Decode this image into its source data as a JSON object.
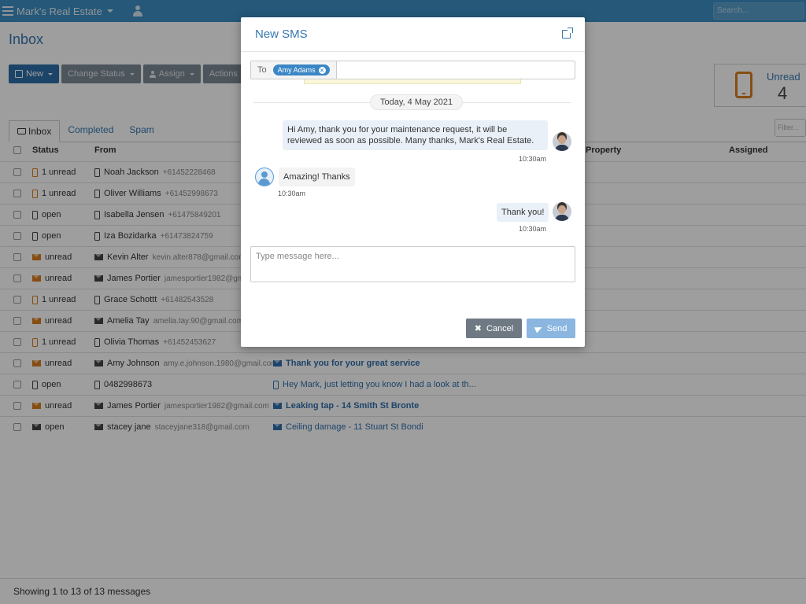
{
  "navbar": {
    "brand": "Mark's Real Estate",
    "search_placeholder": "Search..."
  },
  "page": {
    "title": "Inbox"
  },
  "toolbar": {
    "new_label": "New",
    "change_status_label": "Change Status",
    "assign_label": "Assign",
    "actions_label": "Actions"
  },
  "unread_panel": {
    "label": "Unread",
    "count": "4",
    "accent_color": "#d87c1e"
  },
  "tabs": [
    {
      "label": "Inbox"
    },
    {
      "label": "Completed"
    },
    {
      "label": "Spam"
    }
  ],
  "filter_placeholder": "Filter...",
  "columns": {
    "status": "Status",
    "from": "From",
    "property": "Property",
    "assigned": "Assigned"
  },
  "rows": [
    {
      "status_icon": "phone-icon",
      "status_color": "orange",
      "status": "1 unread",
      "from_icon": "phone-icon",
      "from_name": "Noah Jackson",
      "from_detail": "+61452228468",
      "subject": "",
      "subject_icon": ""
    },
    {
      "status_icon": "phone-icon",
      "status_color": "orange",
      "status": "1 unread",
      "from_icon": "phone-icon",
      "from_name": "Oliver Williams",
      "from_detail": "+61452998673",
      "subject": "",
      "subject_icon": ""
    },
    {
      "status_icon": "phone-icon",
      "status_color": "dark",
      "status": "open",
      "from_icon": "phone-icon",
      "from_name": "Isabella Jensen",
      "from_detail": "+61475849201",
      "subject": "",
      "subject_icon": ""
    },
    {
      "status_icon": "phone-icon",
      "status_color": "dark",
      "status": "open",
      "from_icon": "phone-icon",
      "from_name": "Iza Bozidarka",
      "from_detail": "+61473824759",
      "subject": "",
      "subject_icon": ""
    },
    {
      "status_icon": "envelope-icon",
      "status_color": "orange",
      "status": "unread",
      "from_icon": "envelope-icon",
      "from_name": "Kevin Alter",
      "from_detail": "kevin.alter878@gmail.com",
      "subject": "",
      "subject_icon": ""
    },
    {
      "status_icon": "envelope-icon",
      "status_color": "orange",
      "status": "unread",
      "from_icon": "envelope-icon",
      "from_name": "James Portier",
      "from_detail": "jamesportier1982@gmail.c",
      "subject": "",
      "subject_icon": ""
    },
    {
      "status_icon": "phone-icon",
      "status_color": "orange",
      "status": "1 unread",
      "from_icon": "phone-icon",
      "from_name": "Grace Schottt",
      "from_detail": "+61482543528",
      "subject": "",
      "subject_icon": ""
    },
    {
      "status_icon": "envelope-icon",
      "status_color": "orange",
      "status": "unread",
      "from_icon": "envelope-icon",
      "from_name": "Amelia Tay",
      "from_detail": "amelia.tay.90@gmail.com",
      "subject": "",
      "subject_icon": ""
    },
    {
      "status_icon": "phone-icon",
      "status_color": "orange",
      "status": "1 unread",
      "from_icon": "phone-icon",
      "from_name": "Olivia Thomas",
      "from_detail": "+61452453627",
      "subject": "",
      "subject_icon": ""
    },
    {
      "status_icon": "envelope-icon",
      "status_color": "orange",
      "status": "unread",
      "from_icon": "envelope-icon",
      "from_name": "Amy Johnson",
      "from_detail": "amy.e.johnson.1980@gmail.com",
      "subject": "Thank you for your great service",
      "subject_icon": "envelope-icon",
      "subject_bold": true
    },
    {
      "status_icon": "phone-icon",
      "status_color": "dark",
      "status": "open",
      "from_icon": "phone-icon",
      "from_name": "0482998673",
      "from_detail": "",
      "subject": "Hey Mark, just letting you know I had a look at th...",
      "subject_icon": "phone-icon",
      "subject_bold": false
    },
    {
      "status_icon": "envelope-icon",
      "status_color": "orange",
      "status": "unread",
      "from_icon": "envelope-icon",
      "from_name": "James Portier",
      "from_detail": "jamesportier1982@gmail.com",
      "subject": "Leaking tap - 14 Smith St Bronte",
      "subject_icon": "envelope-icon",
      "subject_bold": true
    },
    {
      "status_icon": "envelope-icon",
      "status_color": "dark",
      "status": "open",
      "from_icon": "envelope-icon",
      "from_name": "stacey jane",
      "from_detail": "staceyjane318@gmail.com",
      "subject": "Ceiling damage - 11 Stuart St Bondi",
      "subject_icon": "envelope-icon",
      "subject_bold": false
    }
  ],
  "footer": {
    "summary": "Showing 1 to 13 of 13 messages"
  },
  "modal": {
    "title": "New SMS",
    "to_label": "To",
    "recipient": "Amy Adams",
    "date_separator": "Today, 4 May 2021",
    "messages": [
      {
        "direction": "outgoing",
        "text": "Hi Amy, thank you for your maintenance request, it will be reviewed as soon as possible. Many thanks, Mark's Real Estate.",
        "time": "10:30am"
      },
      {
        "direction": "incoming",
        "text": "Amazing! Thanks",
        "time": "10:30am"
      },
      {
        "direction": "outgoing",
        "text": "Thank you!",
        "time": "10:30am"
      }
    ],
    "compose_placeholder": "Type message here...",
    "cancel_label": "Cancel",
    "send_label": "Send"
  },
  "colors": {
    "brand_blue": "#3577b0",
    "navbar": "#3c8fc4",
    "unread_orange": "#d87c1e"
  }
}
